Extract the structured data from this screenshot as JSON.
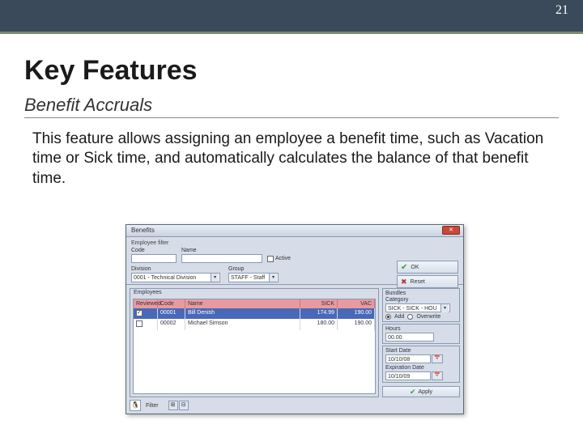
{
  "page_number": "21",
  "title": "Key Features",
  "subtitle": "Benefit Accruals",
  "body": "This feature allows assigning an employee a benefit time, such as Vacation time or Sick time, and automatically calculates the balance of that benefit time.",
  "dialog": {
    "title": "Benefits",
    "close_glyph": "✕",
    "filter_header": "Employee filter",
    "labels": {
      "code": "Code",
      "name": "Name",
      "active": "Active",
      "division": "Division",
      "group": "Group"
    },
    "division_value": "0001 - Technical Division",
    "group_value": "STAFF - Staff",
    "btn_ok": "OK",
    "btn_reset": "Reset",
    "employees_label": "Employees",
    "columns": {
      "reviewed": "Reviewed",
      "code": "Code",
      "name": "Name",
      "sick": "SICK",
      "vac": "VAC"
    },
    "rows": [
      {
        "checked": true,
        "code": "00001",
        "name": "Bill Denish",
        "sick": "174.99",
        "vac": "190.00"
      },
      {
        "checked": false,
        "code": "00002",
        "name": "Michael Simson",
        "sick": "180.00",
        "vac": "190.00"
      }
    ],
    "bundles_label": "Bundles",
    "category_label": "Category",
    "category_value": "SICK - SICK - HOU",
    "mode_add": "Add",
    "mode_overwrite": "Overwrite",
    "hours_label": "Hours",
    "hours_value": "00.00",
    "start_label": "Start Date",
    "start_value": "10/10/08",
    "exp_label": "Expiration Date",
    "exp_value": "10/10/09",
    "apply_label": "Apply",
    "footer_filter": "Filter"
  }
}
